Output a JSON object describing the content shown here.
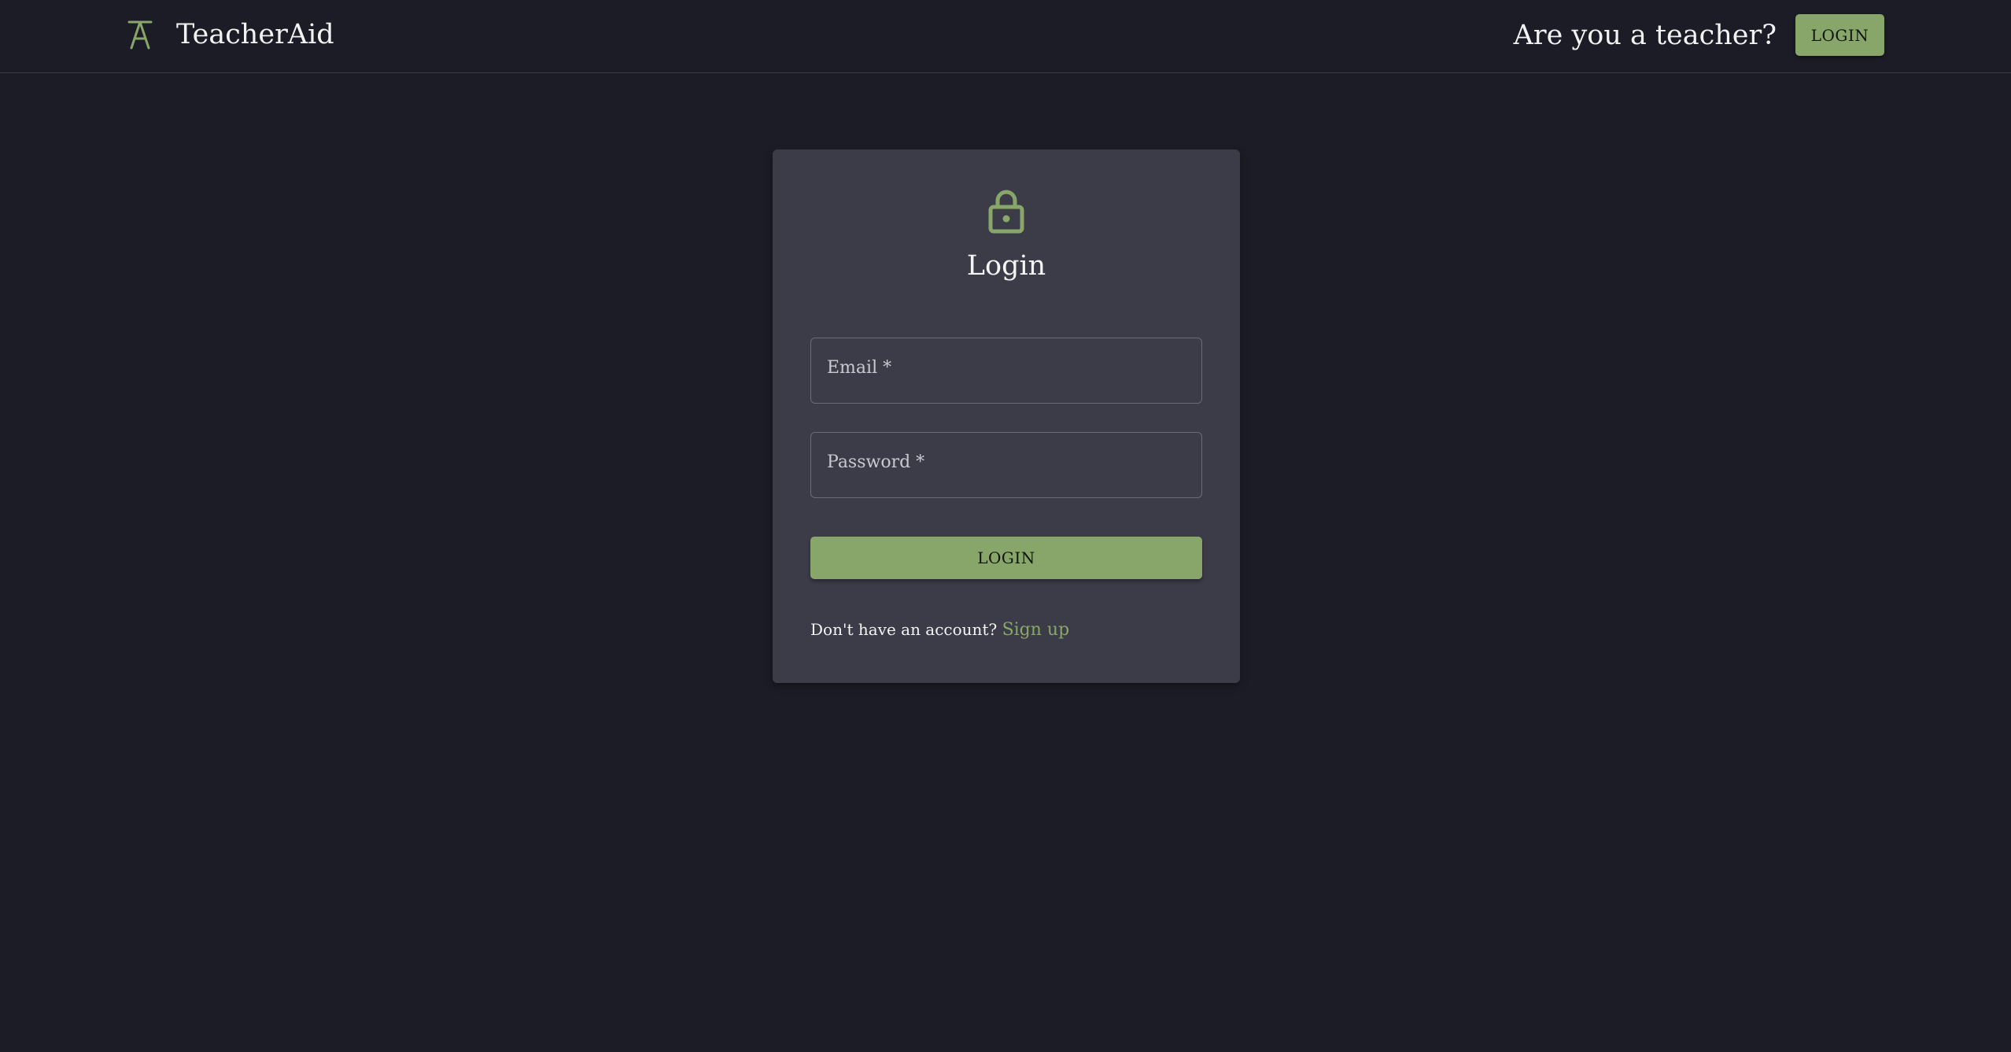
{
  "header": {
    "brand_name": "TeacherAid",
    "logo_icon": "teacheraid-logo-icon",
    "teacher_prompt": "Are you a teacher?",
    "login_label": "LOGIN"
  },
  "login_card": {
    "icon": "lock-icon",
    "title": "Login",
    "email_label": "Email *",
    "email_value": "",
    "password_label": "Password *",
    "password_value": "",
    "submit_label": "LOGIN",
    "signup_prompt": "Don't have an account?",
    "signup_link": "Sign up"
  },
  "colors": {
    "background": "#1c1c27",
    "card": "#3c3c49",
    "accent": "#88a66a",
    "text": "#ffffff"
  }
}
